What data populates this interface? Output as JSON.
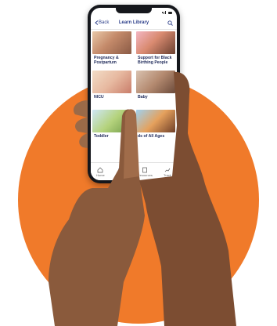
{
  "colors": {
    "accent_orange": "#F07A2A",
    "brand_navy": "#2D3F8A",
    "phone_frame": "#15171C"
  },
  "icons": {
    "back": "chevron-left-icon",
    "search": "search-icon",
    "home": "home-icon",
    "badges": "heart-badge-icon",
    "resources": "book-icon",
    "track": "chart-line-icon"
  },
  "header": {
    "back_label": "Back",
    "title": "Learn Library"
  },
  "library": {
    "cards": [
      {
        "label": "Pregnancy & Postpartum"
      },
      {
        "label": "Support for Black Birthing People"
      },
      {
        "label": "NICU"
      },
      {
        "label": "Baby"
      },
      {
        "label": "Toddler"
      },
      {
        "label": "ds of All Ages"
      }
    ]
  },
  "tabs": [
    {
      "label": "Home"
    },
    {
      "label": "Badges"
    },
    {
      "label": "Resources"
    },
    {
      "label": "Track"
    }
  ]
}
